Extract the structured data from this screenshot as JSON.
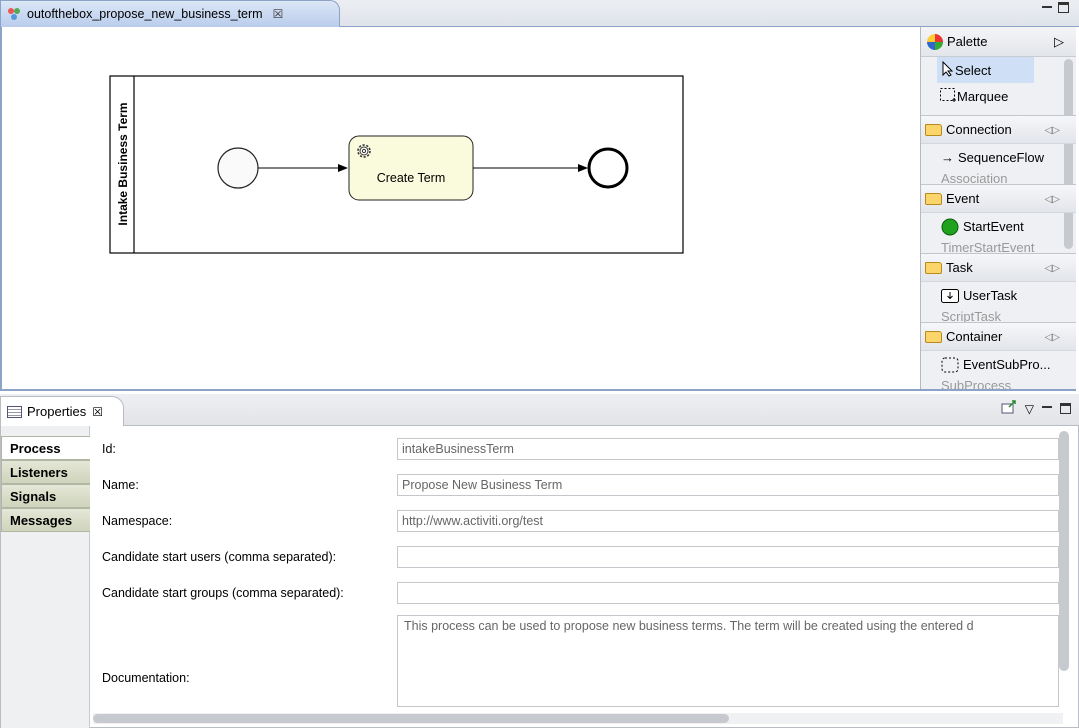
{
  "editor": {
    "tab_title": "outofthebox_propose_new_business_term",
    "tab_close_glyph": "☒"
  },
  "diagram": {
    "pool_label": "Intake Business Term",
    "task_label": "Create Term",
    "task_icon": "gear-icon"
  },
  "palette": {
    "title": "Palette",
    "tools": [
      {
        "label": "Select",
        "icon": "arrow-cursor-icon"
      },
      {
        "label": "Marquee",
        "icon": "marquee-icon"
      }
    ],
    "drawers": [
      {
        "label": "Connection",
        "entries": [
          "SequenceFlow",
          "Association"
        ]
      },
      {
        "label": "Event",
        "entries": [
          "StartEvent",
          "TimerStartEvent"
        ]
      },
      {
        "label": "Task",
        "entries": [
          "UserTask",
          "ScriptTask"
        ]
      },
      {
        "label": "Container",
        "entries": [
          "EventSubPro...",
          "SubProcess"
        ]
      }
    ]
  },
  "properties": {
    "tab_title": "Properties",
    "side_tabs": [
      "Process",
      "Listeners",
      "Signals",
      "Messages"
    ],
    "active_tab": "Process",
    "fields": {
      "id_label": "Id:",
      "id_value": "intakeBusinessTerm",
      "name_label": "Name:",
      "name_value": "Propose New Business Term",
      "namespace_label": "Namespace:",
      "namespace_value": "http://www.activiti.org/test",
      "users_label": "Candidate start users (comma separated):",
      "users_value": "",
      "groups_label": "Candidate start groups (comma separated):",
      "groups_value": "",
      "documentation_label": "Documentation:",
      "documentation_value": "This process can be used to propose new business terms. The term will be created using the entered d"
    }
  },
  "colors": {
    "accent_border": "#8da2c7",
    "task_fill": "#fafadc",
    "start_event_green": "#1fa31f"
  }
}
